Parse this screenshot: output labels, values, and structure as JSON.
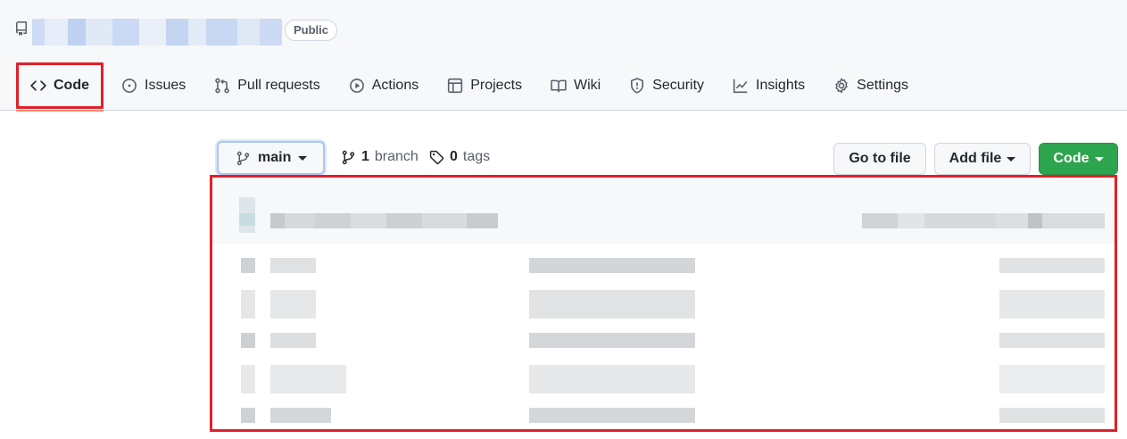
{
  "repo": {
    "visibility_badge": "Public"
  },
  "tabs": [
    {
      "label": "Code",
      "icon": "code-icon",
      "active": true
    },
    {
      "label": "Issues",
      "icon": "issue-icon"
    },
    {
      "label": "Pull requests",
      "icon": "pull-request-icon"
    },
    {
      "label": "Actions",
      "icon": "play-icon"
    },
    {
      "label": "Projects",
      "icon": "table-icon"
    },
    {
      "label": "Wiki",
      "icon": "book-icon"
    },
    {
      "label": "Security",
      "icon": "shield-icon"
    },
    {
      "label": "Insights",
      "icon": "graph-icon"
    },
    {
      "label": "Settings",
      "icon": "gear-icon"
    }
  ],
  "toolbar": {
    "branch": "main",
    "branch_count": "1",
    "branch_label": "branch",
    "tag_count": "0",
    "tag_label": "tags",
    "go_to_file": "Go to file",
    "add_file": "Add file",
    "code": "Code"
  },
  "colors": {
    "highlight": "#e0202a",
    "primary_button": "#2da44e"
  }
}
